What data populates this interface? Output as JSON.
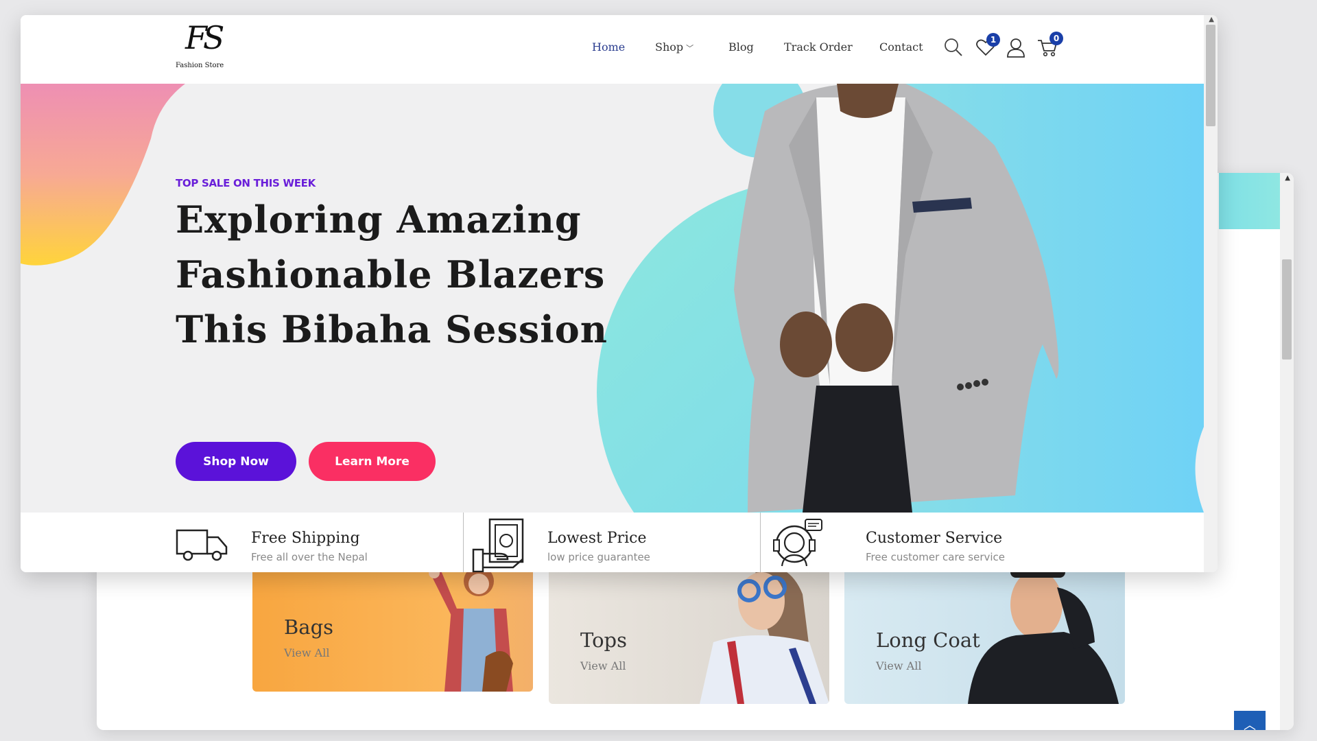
{
  "header": {
    "logo_mark": "FS",
    "logo_text": "Fashion Store",
    "nav": [
      {
        "label": "Home",
        "active": true
      },
      {
        "label": "Shop",
        "has_dropdown": true
      },
      {
        "label": "Blog"
      },
      {
        "label": "Track Order"
      },
      {
        "label": "Contact"
      }
    ],
    "wishlist_count": "1",
    "cart_count": "0"
  },
  "hero": {
    "kicker": "TOP SALE ON THIS WEEK",
    "title_lines": [
      "Exploring Amazing",
      "Fashionable Blazers",
      "This Bibaha Session"
    ],
    "shop_now_label": "Shop Now",
    "learn_more_label": "Learn More"
  },
  "features": [
    {
      "icon": "truck-icon",
      "title": "Free Shipping",
      "subtitle": "Free all over the Nepal"
    },
    {
      "icon": "cash-hand-icon",
      "title": "Lowest Price",
      "subtitle": "low price guarantee"
    },
    {
      "icon": "support-agent-icon",
      "title": "Customer Service",
      "subtitle": "Free customer care service"
    }
  ],
  "categories": [
    {
      "title": "Bags",
      "link": "View All"
    },
    {
      "title": "Tops",
      "link": "View All"
    },
    {
      "title": "Long Coat",
      "link": "View All"
    }
  ],
  "colors": {
    "accent_purple": "#5b12d9",
    "accent_pink": "#fa2f63",
    "nav_active": "#2a3d8f",
    "badge_blue": "#1a3fa8",
    "teal": "#7fe0e6"
  }
}
